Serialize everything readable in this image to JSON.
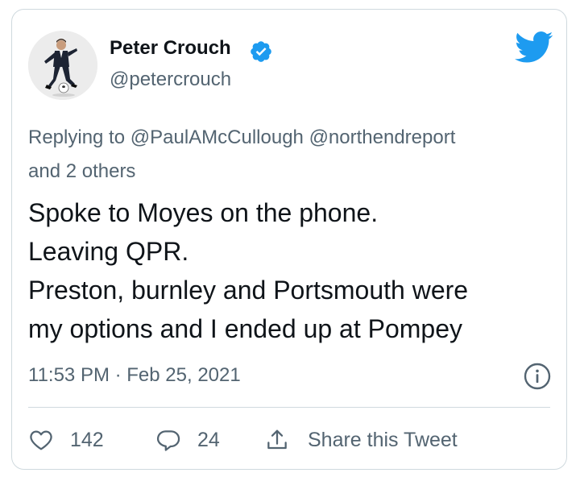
{
  "author": {
    "display_name": "Peter Crouch",
    "handle": "@petercrouch"
  },
  "reply_context": {
    "prefix": "Replying to",
    "mentions": [
      "@PaulAMcCullough",
      "@northendreport"
    ],
    "suffix": "and 2 others"
  },
  "tweet": {
    "lines": [
      "Spoke to Moyes on the phone.",
      "Leaving QPR.",
      "Preston, burnley and Portsmouth were",
      "my options and I ended up at Pompey"
    ],
    "timestamp": "11:53 PM · Feb 25, 2021"
  },
  "actions": {
    "like_count": "142",
    "reply_count": "24",
    "share_label": "Share this Tweet"
  },
  "icons": {
    "verified": "verified-badge-icon",
    "brand": "twitter-bird-icon",
    "info": "info-icon",
    "like": "heart-icon",
    "reply": "speech-bubble-icon",
    "share": "share-upload-icon"
  },
  "colors": {
    "brand_blue": "#1d9bf0",
    "secondary_text": "#536471",
    "primary_text": "#0f1419",
    "border": "#cfd9de"
  }
}
